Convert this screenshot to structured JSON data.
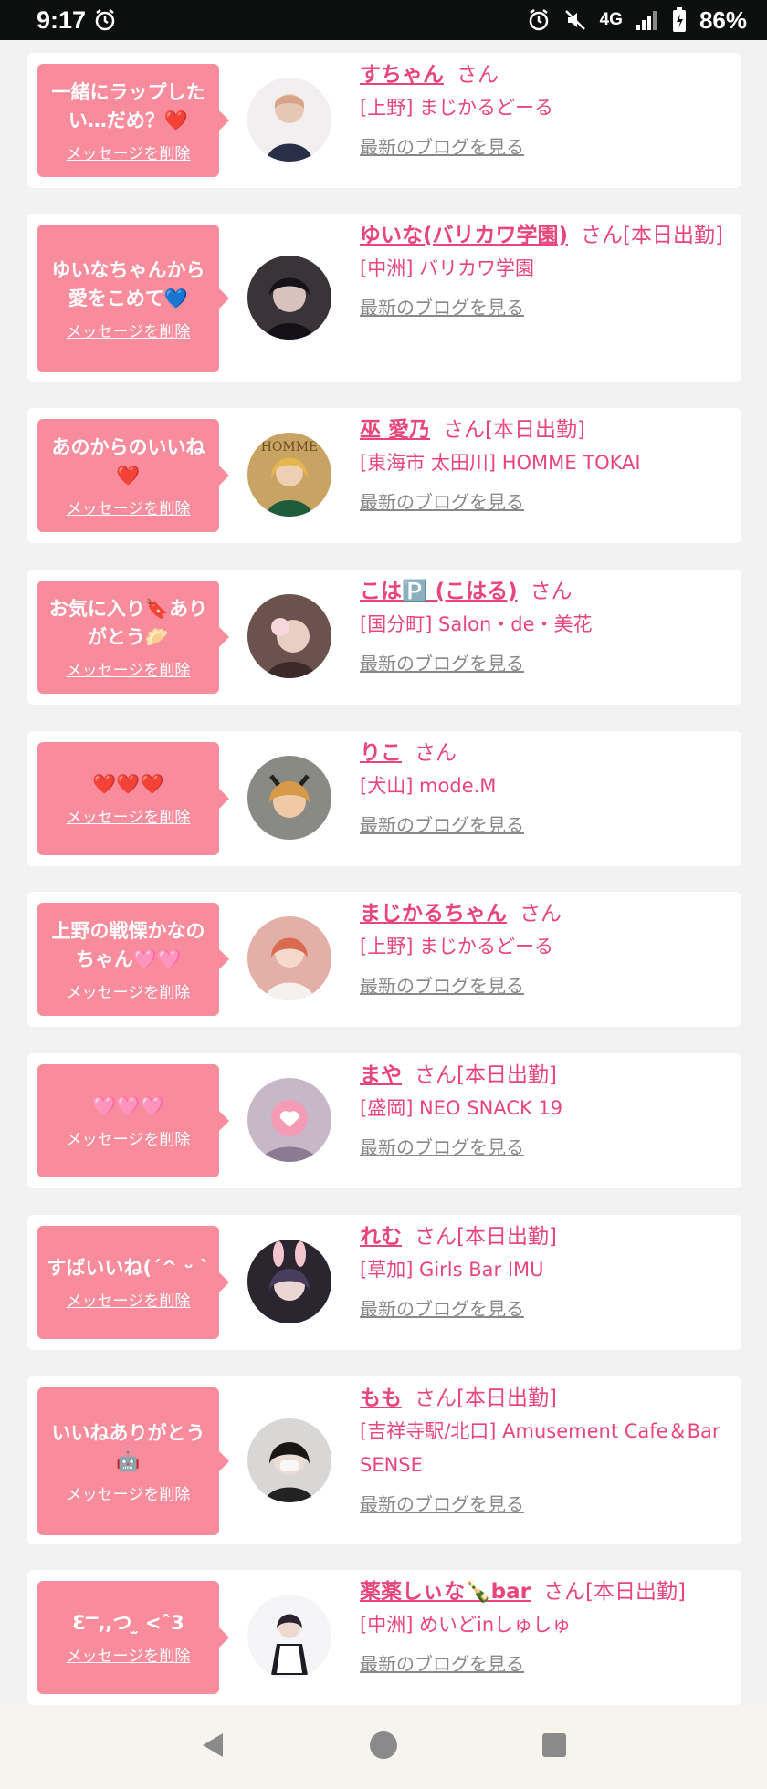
{
  "status_bar": {
    "time": "9:17",
    "network": "4G",
    "battery": "86%",
    "icons": [
      "alarm-icon",
      "alarm-icon",
      "mute-icon",
      "signal-icon",
      "battery-icon"
    ]
  },
  "colors": {
    "accent_pink": "#e8467a",
    "bubble_pink": "#f98c9c",
    "link_gray": "#888888"
  },
  "delete_label": "メッセージを削除",
  "blog_label": "最新のブログを見る",
  "items": [
    {
      "message": "一緒にラップしたい…だめ？❤️",
      "name": "すちゃん",
      "suffix": "さん",
      "shop": "[上野] まじかるどーる"
    },
    {
      "message": "ゆいなちゃんから愛をこめて💙",
      "name": "ゆいな(バリカワ学園)",
      "suffix": "さん[本日出勤]",
      "shop": "[中洲] バリカワ学園"
    },
    {
      "message": "あのからのいいね❤️",
      "name": "巫 愛乃",
      "suffix": "さん[本日出勤]",
      "shop": "[東海市 太田川] HOMME TOKAI"
    },
    {
      "message": "お気に入り🔖ありがとう🥟",
      "name": "こは🅿️ (こはる)",
      "suffix": "さん",
      "shop": "[国分町] Salon・de・美花"
    },
    {
      "message": "❤️❤️❤️",
      "name": "りこ",
      "suffix": "さん",
      "shop": "[犬山] mode.M"
    },
    {
      "message": "上野の戦慄かなのちゃん🩷🩷",
      "name": "まじかるちゃん",
      "suffix": "さん",
      "shop": "[上野] まじかるどーる"
    },
    {
      "message": "🩷🩷🩷",
      "name": "まや",
      "suffix": "さん[本日出勤]",
      "shop": "[盛岡] NEO SNACK 19"
    },
    {
      "message": "すばいいね(ˊ^ ᵕ ˋ",
      "name": "れむ",
      "suffix": "さん[本日出勤]",
      "shop": "[草加] Girls Bar IMU"
    },
    {
      "message": "いいねありがとう🤖",
      "name": "もも",
      "suffix": "さん[本日出勤]",
      "shop": "[吉祥寺駅/北口] Amusement Cafe＆Bar SENSE"
    },
    {
      "message": "ƐⲺ,,つ ̫ <ˆ3",
      "name": "薬薬しぃな🍾bar",
      "suffix": "さん[本日出勤]",
      "shop": "[中洲] めいどinしゅしゅ"
    }
  ],
  "nav_bar": {
    "icons": [
      "back-icon",
      "home-icon",
      "recents-icon"
    ]
  }
}
